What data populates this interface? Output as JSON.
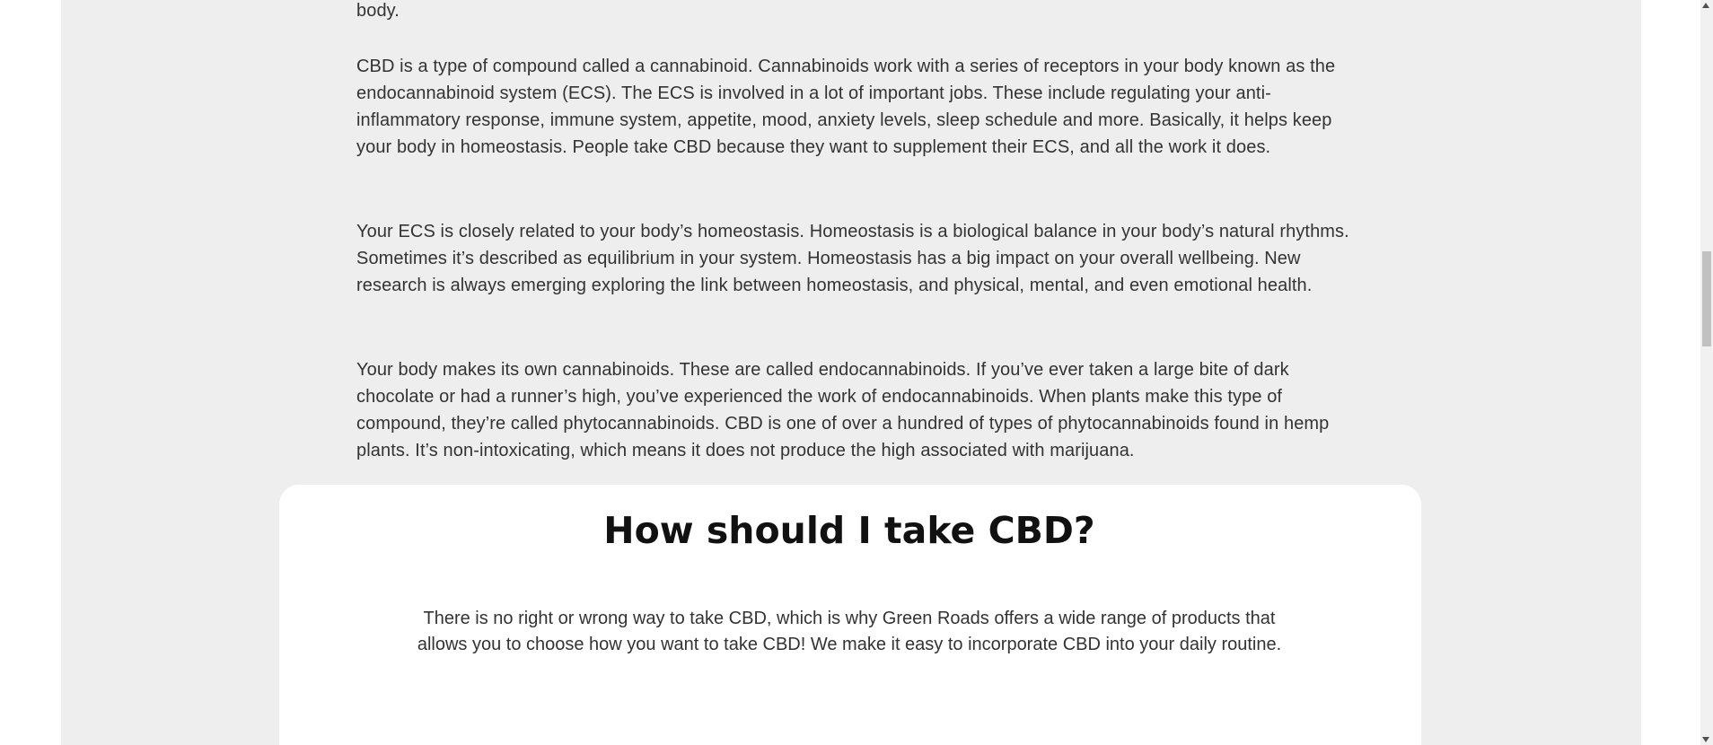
{
  "article": {
    "paragraphs": [
      "body.",
      "CBD is a type of compound called a cannabinoid. Cannabinoids work with a series of receptors in your body known as the endocannabinoid system (ECS). The ECS is involved in a lot of important jobs. These include regulating your anti-inflammatory response, immune system, appetite, mood, anxiety levels, sleep schedule and more. Basically, it helps keep your body in homeostasis. People take CBD because they want to supplement their ECS, and all the work it does.",
      "Your ECS is closely related to your body’s homeostasis. Homeostasis is a biological balance in your body’s natural rhythms. Sometimes it’s described as equilibrium in your system. Homeostasis has a big impact on your overall wellbeing. New research is always emerging exploring the link between homeostasis, and physical, mental, and even emotional health.",
      "Your body makes its own cannabinoids. These are called endocannabinoids. If you’ve ever taken a large bite of dark chocolate or had a runner’s high, you’ve experienced the work of endocannabinoids. When plants make this type of compound, they’re called phytocannabinoids. CBD is one of over a hundred of types of phytocannabinoids found in hemp plants. It’s non-intoxicating, which means it does not produce the high associated with marijuana."
    ]
  },
  "section": {
    "title": "How should I take CBD?",
    "body": "There is no right or wrong way to take CBD, which is why Green Roads offers a wide range of products that allows you to choose how you want to take CBD! We make it easy to incorporate CBD into your daily routine."
  },
  "scrollbar": {
    "up_icon": "triangle-up",
    "down_icon": "triangle-down"
  }
}
